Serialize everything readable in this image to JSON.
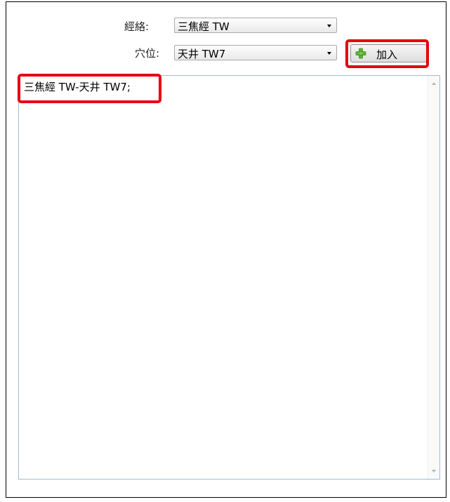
{
  "meridian": {
    "label": "經絡:",
    "selected": "三焦經 TW"
  },
  "acupoint": {
    "label": "穴位:",
    "selected": "天井 TW7"
  },
  "add_button": {
    "label": "加入",
    "icon": "plus-icon"
  },
  "textarea": {
    "content": "三焦經 TW-天井 TW7;"
  },
  "colors": {
    "highlight": "#e60012",
    "plus_icon": "#5fb336"
  }
}
